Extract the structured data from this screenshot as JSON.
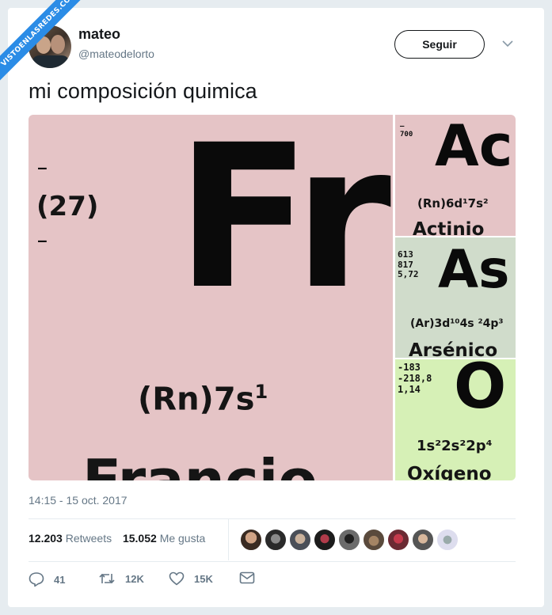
{
  "watermark": {
    "text": "VISTOENLASREDES.COM"
  },
  "user": {
    "name": "mateo",
    "handle": "@mateodelorto"
  },
  "follow_button": "Seguir",
  "tweet_text": "mi composición quimica",
  "media": {
    "tiles": [
      {
        "symbol": "Fr",
        "mass": "(27)",
        "dash1": "–",
        "dash2": "–",
        "config_base": "(Rn)7s",
        "config_sup": "1",
        "name": "Francio"
      },
      {
        "symbol": "Ac",
        "small": "–\n700",
        "config": "(Rn)6d¹7s²",
        "name": "Actinio"
      },
      {
        "symbol": "As",
        "small": "613\n817\n5,72",
        "config": "(Ar)3d¹⁰4s ²4p³",
        "name": "Arsénico"
      },
      {
        "symbol": "O",
        "small": "-183\n-218,8\n1,14",
        "config": "1s²2s²2p⁴",
        "name": "Oxígeno"
      }
    ]
  },
  "timestamp": "14:15 - 15 oct. 2017",
  "stats": {
    "retweets_count": "12.203",
    "retweets_label": "Retweets",
    "likes_count": "15.052",
    "likes_label": "Me gusta"
  },
  "actions": {
    "replies": "41",
    "retweets": "12K",
    "likes": "15K"
  },
  "colors": {
    "fr_bg": "#e5c4c6",
    "as_bg": "#d0dccb",
    "o_bg": "#d6f0b6",
    "page_bg": "#e6ecf0",
    "muted": "#657786"
  }
}
